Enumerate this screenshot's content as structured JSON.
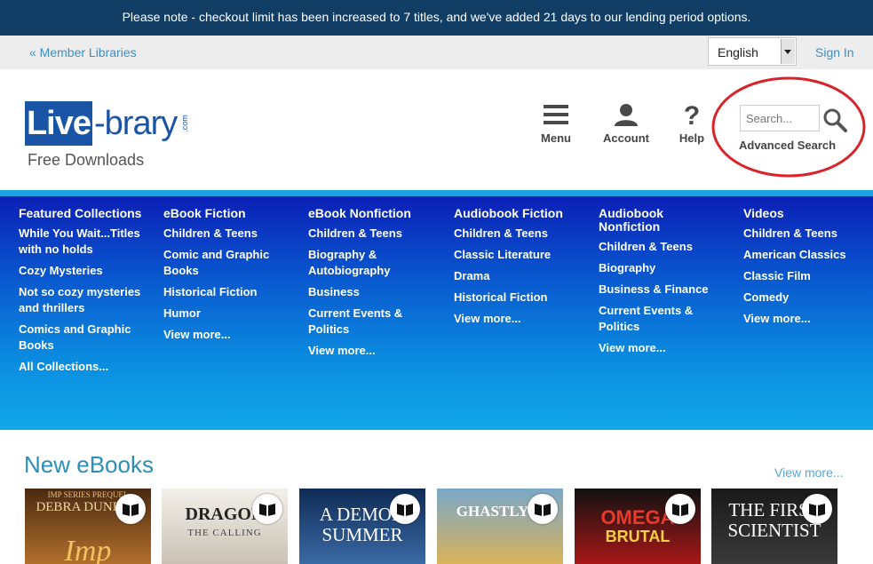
{
  "notice": "Please note - checkout limit has been increased to 7 titles, and we've added 21 days to our lending period options.",
  "topbar": {
    "member_link": "« Member Libraries",
    "language": "English",
    "sign_in": "Sign In"
  },
  "logo": {
    "box_text": "Live",
    "text": "-brary",
    "com": ".com",
    "subtitle": "Free Downloads"
  },
  "header_icons": {
    "menu": "Menu",
    "account": "Account",
    "help": "Help"
  },
  "search": {
    "placeholder": "Search...",
    "advanced": "Advanced Search",
    "highlight_color": "#d9232a"
  },
  "nav": {
    "columns": [
      {
        "title": "Featured Collections",
        "items": [
          "While You Wait...Titles with no holds",
          "Cozy Mysteries",
          "Not so cozy mysteries and thrillers",
          "Comics and Graphic Books",
          "All Collections..."
        ]
      },
      {
        "title": "eBook Fiction",
        "items": [
          "Children & Teens",
          "Comic and Graphic Books",
          "Historical Fiction",
          "Humor",
          "View more..."
        ]
      },
      {
        "title": "eBook Nonfiction",
        "items": [
          "Children & Teens",
          "Biography & Autobiography",
          "Business",
          "Current Events & Politics",
          "View more..."
        ]
      },
      {
        "title": "Audiobook Fiction",
        "items": [
          "Children & Teens",
          "Classic Literature",
          "Drama",
          "Historical Fiction",
          "View more..."
        ]
      },
      {
        "title": "Audiobook Nonfiction",
        "items": [
          "Children & Teens",
          "Biography",
          "Business & Finance",
          "Current Events & Politics",
          "View more..."
        ]
      },
      {
        "title": "Videos",
        "items": [
          "Children & Teens",
          "American Classics",
          "Classic Film",
          "Comedy",
          "View more..."
        ]
      }
    ]
  },
  "new_ebooks": {
    "title": "New eBooks",
    "view_more": "View more...",
    "books": [
      {
        "title": "Imp",
        "author": "DEBRA DUNBAR",
        "series": "IMP SERIES PREQUEL",
        "colors": [
          "#4a2a12",
          "#b3702c"
        ]
      },
      {
        "title": "DRAGON",
        "subtitle": "THE CALLING",
        "colors": [
          "#f3f0ea",
          "#c9c2b4"
        ]
      },
      {
        "title": "A DEMON",
        "subtitle": "SUMMER",
        "colors": [
          "#0f2b55",
          "#3a6aa5"
        ]
      },
      {
        "title": "GHASTLY G",
        "colors": [
          "#7aa8c8",
          "#d9b25a"
        ]
      },
      {
        "title": "OMEGA",
        "subtitle": "BRUTAL",
        "colors": [
          "#111111",
          "#a81818"
        ]
      },
      {
        "title": "THE FIRST",
        "subtitle": "SCIENTIST",
        "colors": [
          "#1a1a1a",
          "#3a3a3a"
        ]
      }
    ]
  }
}
